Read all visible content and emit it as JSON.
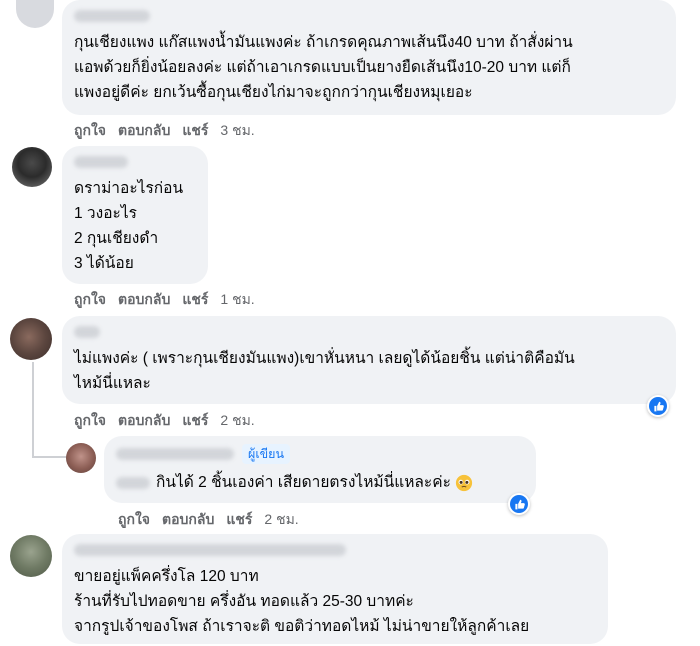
{
  "comments": [
    {
      "text": "กุนเชียงแพง แก๊สแพงน้ำมันแพงค่ะ ถ้าเกรดคุณภาพเส้นนึง40 บาท ถ้าสั่งผ่าน\nแอพด้วยก็ยิ่งน้อยลงค่ะ แต่ถ้าเอาเกรดแบบเป็นยางยืดเส้นนึง10-20 บาท แต่ก็\nแพงอยู่ดีค่ะ ยกเว้นซื้อกุนเชียงไก่มาจะถูกกว่ากุนเชียงหมุเยอะ",
      "actions": {
        "like": "ถูกใจ",
        "reply": "ตอบกลับ",
        "share": "แชร์",
        "time": "3 ชม."
      }
    },
    {
      "text": "ดราม่าอะไรก่อน\n1 วงอะไร\n2 กุนเชียงดำ\n3 ได้น้อย",
      "actions": {
        "like": "ถูกใจ",
        "reply": "ตอบกลับ",
        "share": "แชร์",
        "time": "1 ชม."
      }
    },
    {
      "text": "ไม่แพงค่ะ ( เพราะกุนเชียงมันแพง)เขาหั่นหนา เลยดูได้น้อยชิ้น แต่น่าติคือมัน\nไหม้นี่แหละ",
      "actions": {
        "like": "ถูกใจ",
        "reply": "ตอบกลับ",
        "share": "แชร์",
        "time": "2 ชม."
      }
    },
    {
      "badge": "ผู้เขียน",
      "text": "กินได้ 2 ชิ้นเองค่า เสียดายตรงไหม้นี่แหละค่ะ",
      "actions": {
        "like": "ถูกใจ",
        "reply": "ตอบกลับ",
        "share": "แชร์",
        "time": "2 ชม."
      }
    },
    {
      "text": "ขายอยู่แพ็คครึ่งโล 120 บาท\nร้านที่รับไปทอดขาย ครึ่งอัน ทอดแล้ว 25-30 บาทค่ะ\nจากรูปเจ้าของโพส ถ้าเราจะติ ขอติว่าทอดไหม้ ไม่น่าขายให้ลูกค้าเลย"
    }
  ],
  "colors": {
    "bubble": "#f0f2f5",
    "action": "#65676b",
    "accent": "#1877f2"
  }
}
